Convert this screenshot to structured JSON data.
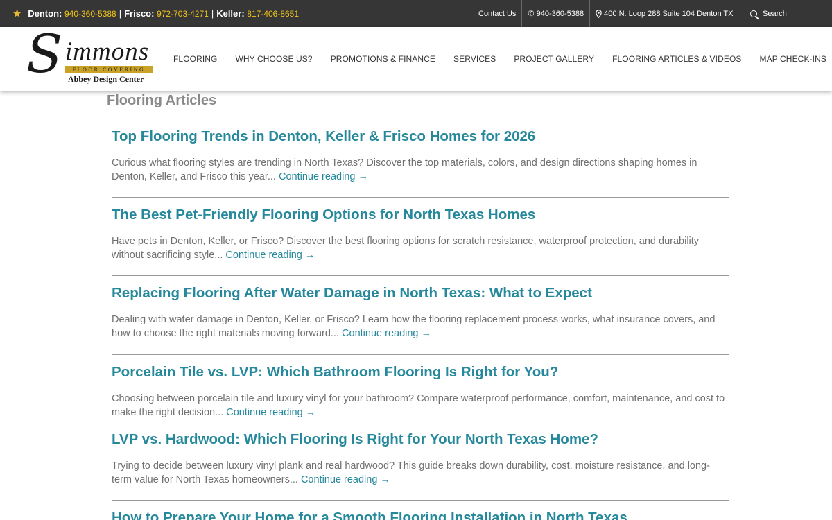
{
  "topbar": {
    "phones": [
      {
        "city": "Denton:",
        "number": "940-360-5388"
      },
      {
        "city": "Frisco:",
        "number": "972-703-4271"
      },
      {
        "city": "Keller:",
        "number": "817-406-8651"
      }
    ],
    "separator": "|",
    "contact_label": "Contact Us",
    "phone_label": "940-360-5388",
    "address_label": "400 N. Loop 288 Suite 104 Denton TX",
    "search_label": "Search"
  },
  "logo": {
    "letter": "S",
    "rest": "immons",
    "tagline": "FLOOR COVERING",
    "subtitle": "Abbey Design Center"
  },
  "nav": {
    "items": [
      "FLOORING",
      "WHY CHOOSE US?",
      "PROMOTIONS & FINANCE",
      "SERVICES",
      "PROJECT GALLERY",
      "FLOORING ARTICLES & VIDEOS",
      "MAP CHECK-INS"
    ]
  },
  "page": {
    "title": "Flooring Articles",
    "continue_label": "Continue reading →",
    "articles": [
      {
        "title": "Top Flooring Trends in Denton, Keller & Frisco Homes for 2026",
        "excerpt": "Curious what flooring styles are trending in North Texas? Discover the top materials, colors, and design directions shaping homes in Denton, Keller, and Frisco this year..."
      },
      {
        "title": "The Best Pet-Friendly Flooring Options for North Texas Homes",
        "excerpt": "Have pets in Denton, Keller, or Frisco? Discover the best flooring options for scratch resistance, waterproof protection, and durability without sacrificing style..."
      },
      {
        "title": "Replacing Flooring After Water Damage in North Texas: What to Expect",
        "excerpt": "Dealing with water damage in Denton, Keller, or Frisco? Learn how the flooring replacement process works, what insurance covers, and how to choose the right materials moving forward..."
      },
      {
        "title": "Porcelain Tile vs. LVP: Which Bathroom Flooring Is Right for You?",
        "excerpt": "Choosing between porcelain tile and luxury vinyl for your bathroom? Compare waterproof performance, comfort, maintenance, and cost to make the right decision..."
      },
      {
        "title": "LVP vs. Hardwood: Which Flooring Is Right for Your North Texas Home?",
        "excerpt": "Trying to decide between luxury vinyl plank and real hardwood? This guide breaks down durability, cost, moisture resistance, and long-term value for North Texas homeowners..."
      },
      {
        "title": "How to Prepare Your Home for a Smooth Flooring Installation in North Texas"
      }
    ]
  },
  "colors": {
    "topbar_bg": "#363636",
    "phone_number": "#f0c419",
    "link_teal": "#25889b",
    "body_text": "#707070",
    "logo_gold": "#c9a227"
  },
  "icons": {
    "star": "star-icon",
    "phone": "phone-icon",
    "location": "map-pin-icon",
    "search": "search-icon"
  }
}
